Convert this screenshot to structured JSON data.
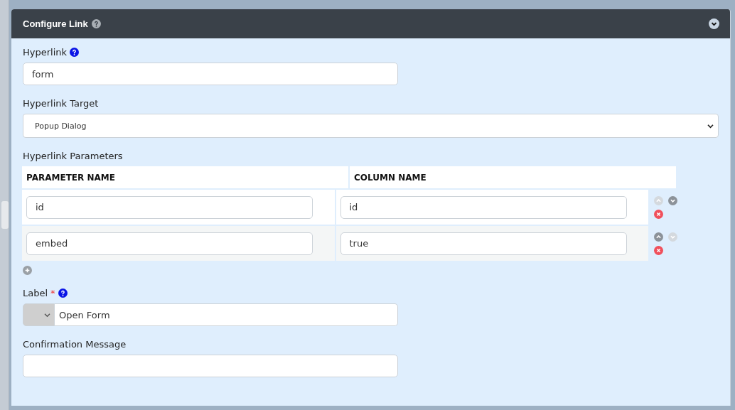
{
  "panel": {
    "title": "Configure Link",
    "expanded": true
  },
  "fields": [
    {
      "kind": "text",
      "label": "Hyperlink",
      "help": true,
      "value": "form"
    },
    {
      "kind": "select",
      "label": "Hyperlink Target",
      "value": "Popup Dialog"
    },
    {
      "kind": "table",
      "label": "Hyperlink Parameters",
      "columns": [
        "PARAMETER NAME",
        "COLUMN NAME"
      ],
      "rows": [
        {
          "cells": [
            "id",
            "id"
          ],
          "up_disabled": true,
          "down_disabled": false
        },
        {
          "cells": [
            "embed",
            "true"
          ],
          "up_disabled": false,
          "down_disabled": true
        }
      ]
    },
    {
      "kind": "prefixed",
      "label": "Label",
      "required_mark": "*",
      "help": true,
      "value": "Open Form"
    },
    {
      "kind": "text",
      "label": "Confirmation Message"
    }
  ]
}
